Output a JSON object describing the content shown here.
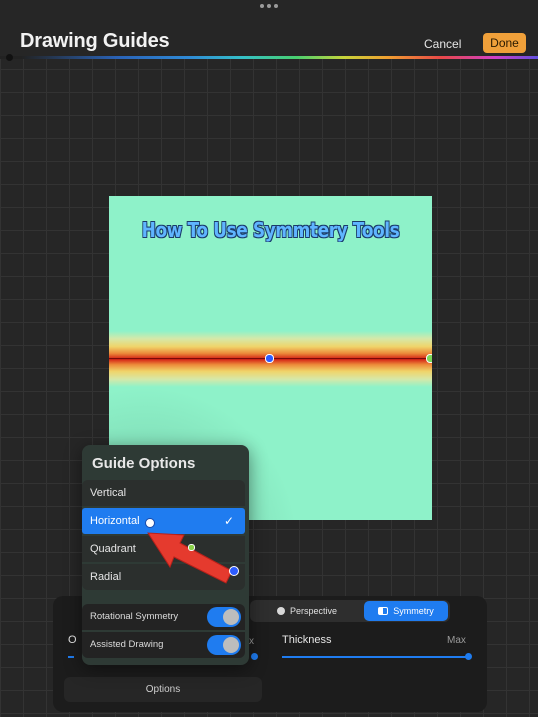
{
  "header": {
    "title": "Drawing Guides",
    "cancel_label": "Cancel",
    "done_label": "Done"
  },
  "canvas": {
    "title_text": "How To Use Symmtery Tools"
  },
  "guide_options": {
    "title": "Guide Options",
    "items": [
      {
        "label": "Vertical",
        "selected": false
      },
      {
        "label": "Horizontal",
        "selected": true
      },
      {
        "label": "Quadrant",
        "selected": false
      },
      {
        "label": "Radial",
        "selected": false
      }
    ],
    "toggles": [
      {
        "label": "Rotational Symmetry",
        "on": true
      },
      {
        "label": "Assisted Drawing",
        "on": true
      }
    ]
  },
  "bottom_panel": {
    "tabs": [
      {
        "label": "Perspective",
        "active": false
      },
      {
        "label": "Symmetry",
        "active": true
      }
    ],
    "thickness_label": "Thickness",
    "max_label": "Max",
    "partial_left_label": "O",
    "partial_x_label": "x",
    "options_label": "Options"
  },
  "colors": {
    "accent": "#1f7cf0",
    "done_button": "#f0a03a",
    "canvas_bg": "#8ef2c9",
    "guide_line": "#c21a14"
  }
}
